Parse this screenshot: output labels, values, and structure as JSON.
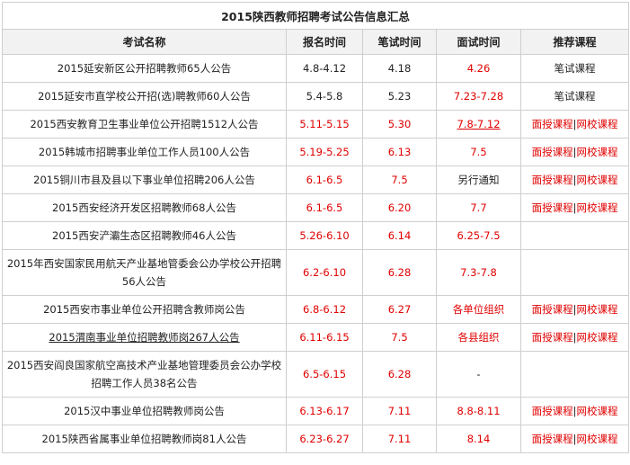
{
  "table": {
    "title": "2015陕西教师招聘考试公告信息汇总",
    "headers": [
      "考试名称",
      "报名时间",
      "笔试时间",
      "面试时间",
      "推荐课程"
    ],
    "rows": [
      {
        "name": "2015延安新区公开招聘教师65人公告",
        "reg": "4.8-4.12",
        "written": "4.18",
        "interview": "4.26",
        "course": "笔试课程"
      },
      {
        "name": "2015延安市直学校公开招(选)聘教师60人公告",
        "reg": "5.4-5.8",
        "written": "5.23",
        "interview": "7.23-7.28",
        "course": "笔试课程"
      },
      {
        "name": "2015西安教育卫生事业单位公开招聘1512人公告",
        "reg": "5.11-5.15",
        "written": "5.30",
        "interview": "7.8-7.12",
        "course_a": "面授课程",
        "course_sep": "|",
        "course_b": "网校课程"
      },
      {
        "name": "2015韩城市招聘事业单位工作人员100人公告",
        "reg": "5.19-5.25",
        "written": "6.13",
        "interview": "7.5",
        "course_a": "面授课程",
        "course_sep": "|",
        "course_b": "网校课程"
      },
      {
        "name": "2015铜川市县及县以下事业单位招聘206人公告",
        "reg": "6.1-6.5",
        "written": "7.5",
        "interview": "另行通知",
        "course_a": "面授课程",
        "course_sep": "|",
        "course_b": "网校课程"
      },
      {
        "name": "2015西安经济开发区招聘教师68人公告",
        "reg": "6.1-6.5",
        "written": "6.20",
        "interview": "7.7",
        "course_a": "面授课程",
        "course_sep": "|",
        "course_b": "网校课程"
      },
      {
        "name": "2015西安浐灞生态区招聘教师46人公告",
        "reg": "5.26-6.10",
        "written": "6.14",
        "interview": "6.25-7.5"
      },
      {
        "name": "2015年西安国家民用航天产业基地管委会公办学校公开招聘56人公告",
        "reg": "6.2-6.10",
        "written": "6.28",
        "interview": "7.3-7.8"
      },
      {
        "name": "2015西安市事业单位公开招聘含教师岗公告",
        "reg": "6.8-6.12",
        "written": "6.27",
        "interview": "各单位组织",
        "course_a": "面授课程",
        "course_sep": "|",
        "course_b": "网校课程"
      },
      {
        "name": "2015渭南事业单位招聘教师岗267人公告",
        "reg": "6.11-6.15",
        "written": "7.5",
        "interview": "各县组织",
        "course_a": "面授课程",
        "course_sep": "|",
        "course_b": "网校课程"
      },
      {
        "name": "2015西安阎良国家航空高技术产业基地管理委员会公办学校招聘工作人员38名公告",
        "reg": "6.5-6.15",
        "written": "6.28",
        "interview": "-"
      },
      {
        "name": "2015汉中事业单位招聘教师岗公告",
        "reg": "6.13-6.17",
        "written": "7.11",
        "interview": "8.8-8.11",
        "course_a": "面授课程",
        "course_sep": "|",
        "course_b": "网校课程"
      },
      {
        "name": "2015陕西省属事业单位招聘教师岗81人公告",
        "reg": "6.23-6.27",
        "written": "7.11",
        "interview": "8.14",
        "course_a": "面授课程",
        "course_sep": "|",
        "course_b": "网校课程"
      }
    ]
  },
  "colors": {
    "accent_red": "#e00000",
    "header_bg": "#f2f2f2",
    "border": "#cfcfcf"
  }
}
